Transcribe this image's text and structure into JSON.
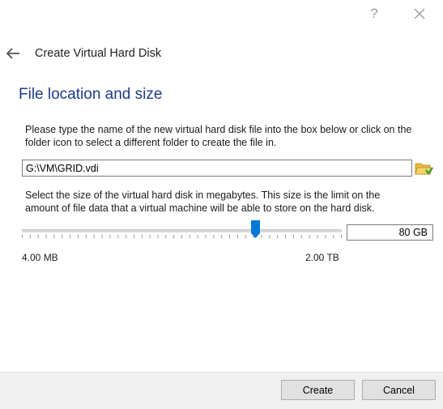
{
  "titlebar": {
    "help_label": "?",
    "close_icon": "close-icon"
  },
  "wizard": {
    "title": "Create Virtual Hard Disk",
    "back_icon": "back-arrow-icon"
  },
  "page": {
    "heading": "File location and size",
    "location_description": "Please type the name of the new virtual hard disk file into the box below or click on the folder icon to select a different folder to create the file in.",
    "file_path": "G:\\VM\\GRID.vdi",
    "folder_icon": "folder-open-icon",
    "size_description": "Select the size of the virtual hard disk in megabytes. This size is the limit on the amount of file data that a virtual machine will be able to store on the hard disk.",
    "size_value": "80 GB",
    "slider_position": 0.73,
    "min_label": "4.00 MB",
    "max_label": "2.00 TB"
  },
  "footer": {
    "create_label": "Create",
    "cancel_label": "Cancel"
  },
  "colors": {
    "heading": "#1e3a8a",
    "accent": "#0078d7",
    "footer_bg": "#f0f0f0"
  }
}
